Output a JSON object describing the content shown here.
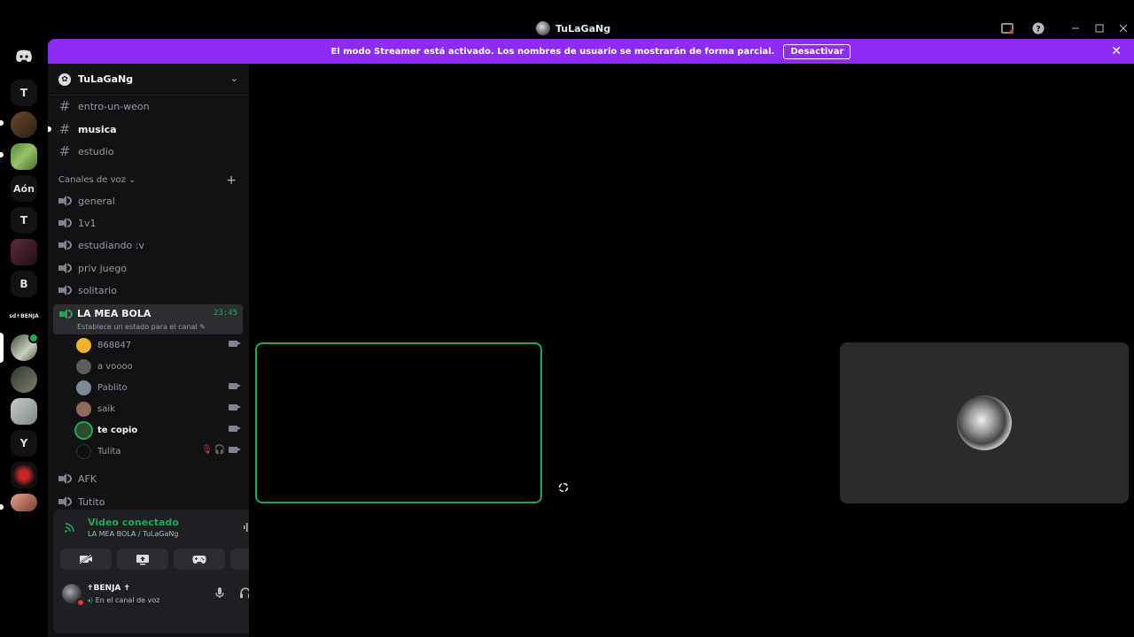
{
  "window": {
    "title": "TuLaGaNg"
  },
  "banner": {
    "message": "El modo Streamer está activado. Los nombres de usuario se mostrarán de forma parcial.",
    "button_label": "Desactivar",
    "color": "#8e2cf5"
  },
  "servers": [
    {
      "label": "T"
    },
    {
      "label": "Aón"
    },
    {
      "label": "T"
    },
    {
      "label": "B"
    },
    {
      "label": "sd✝BENJA"
    },
    {
      "label": "Y"
    }
  ],
  "guild": {
    "name": "TuLaGaNg"
  },
  "text_channels": [
    {
      "name": "entro-un-weon"
    },
    {
      "name": "musica"
    },
    {
      "name": "estudio"
    }
  ],
  "voice_category": {
    "label": "Canales de voz"
  },
  "voice_channels": [
    {
      "name": "general"
    },
    {
      "name": "1v1"
    },
    {
      "name": "estudiando :v"
    },
    {
      "name": "priv juego"
    },
    {
      "name": "solitario"
    }
  ],
  "active_channel": {
    "name": "LA MEA BOLA",
    "timer": "23:45",
    "status_hint": "Establece un estado para el canal"
  },
  "voice_users": [
    {
      "name": "868847",
      "color": "#f0b232"
    },
    {
      "name": "a voooo",
      "color": "#5c5c5c"
    },
    {
      "name": "Pablito",
      "color": "#7d8a99"
    },
    {
      "name": "saik",
      "color": "#8a6b5c"
    },
    {
      "name": "te copio",
      "color": "#2d4a2d"
    },
    {
      "name": "Tulita",
      "color": "#111111"
    }
  ],
  "other_voice_channels": [
    {
      "name": "AFK"
    },
    {
      "name": "Tutito"
    }
  ],
  "voice_connection": {
    "status": "Video conectado",
    "channel_path": "LA MEA BOLA / TuLaGaNg",
    "accent": "#23a55a"
  },
  "user": {
    "name": "✝BENJA ✝",
    "status": "En el canal de voz"
  }
}
